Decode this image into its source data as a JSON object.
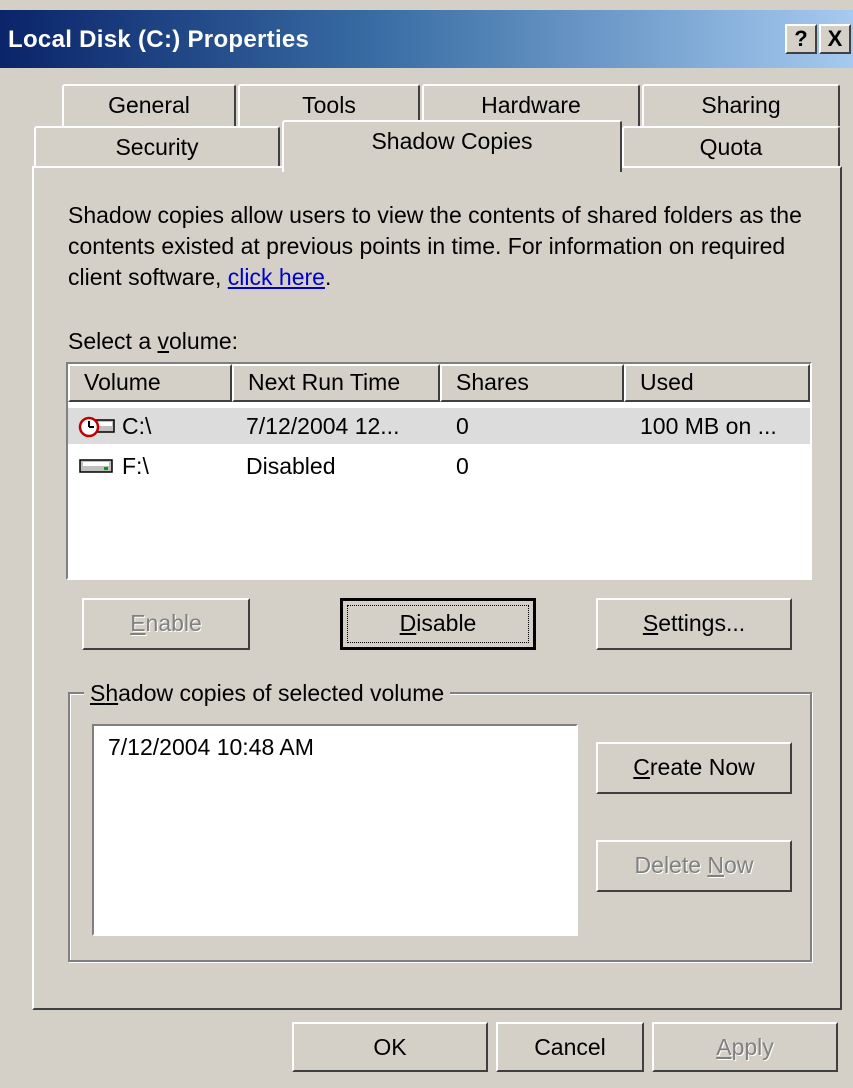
{
  "window": {
    "title": "Local Disk (C:) Properties",
    "help_button": "?",
    "close_button": "X"
  },
  "tabs_row1": [
    "General",
    "Tools",
    "Hardware",
    "Sharing"
  ],
  "tabs_row2": [
    "Security",
    "Shadow Copies",
    "Quota"
  ],
  "active_tab": "Shadow Copies",
  "description": {
    "text": "Shadow copies allow users to view the contents of shared folders as the contents existed at previous points in time. For information on required client software, ",
    "link": "click here",
    "end": "."
  },
  "volume_label": {
    "pre": "Select a ",
    "key": "v",
    "post": "olume:"
  },
  "volume_table": {
    "columns": [
      "Volume",
      "Next Run Time",
      "Shares",
      "Used"
    ],
    "rows": [
      {
        "volume": "C:\\",
        "next_run": "7/12/2004 12...",
        "shares": "0",
        "used": "100 MB on ...",
        "icon": "shadow-copy-drive-icon",
        "selected": true
      },
      {
        "volume": "F:\\",
        "next_run": "Disabled",
        "shares": "0",
        "used": "",
        "icon": "drive-icon",
        "selected": false
      }
    ]
  },
  "buttons": {
    "enable": {
      "key": "E",
      "rest": "nable"
    },
    "disable": {
      "key": "D",
      "rest": "isable"
    },
    "settings": {
      "key": "S",
      "rest": "ettings..."
    },
    "create_now": {
      "key": "C",
      "rest": "reate Now"
    },
    "delete_now": {
      "pre": "Delete ",
      "key": "N",
      "rest": "ow"
    },
    "ok": "OK",
    "cancel": "Cancel",
    "apply": {
      "key": "A",
      "rest": "pply"
    }
  },
  "group": {
    "label_key": "S",
    "label_pre": "",
    "label_k2": "h",
    "label_rest": "adow copies of selected volume"
  },
  "snapshots": [
    "7/12/2004 10:48 AM"
  ]
}
